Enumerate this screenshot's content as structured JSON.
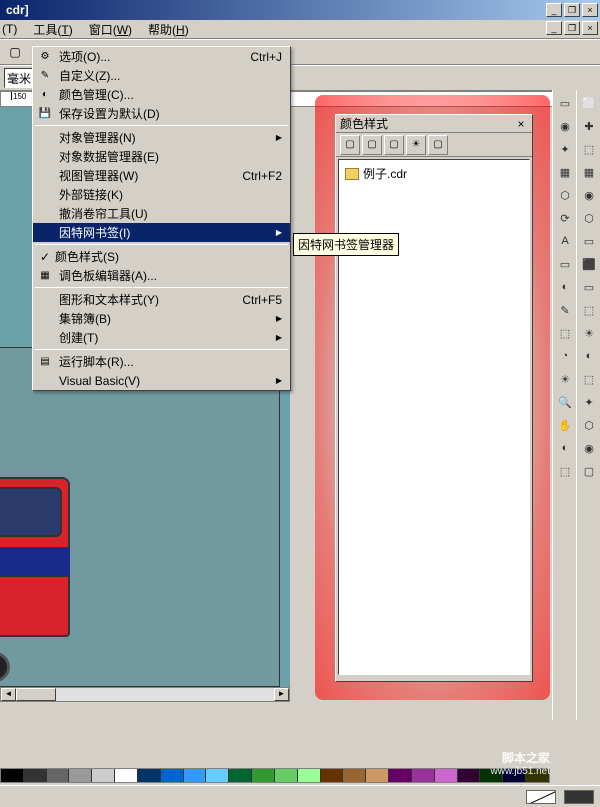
{
  "titlebar": {
    "text": "cdr]"
  },
  "menubar": {
    "items": [
      {
        "label": "工具",
        "key": "T"
      },
      {
        "label": "窗口",
        "key": "W"
      },
      {
        "label": "帮助",
        "key": "H"
      }
    ],
    "partial_left": "(T)"
  },
  "dropdown": {
    "items": [
      {
        "label": "选项(O)...",
        "shortcut": "Ctrl+J",
        "icon": "gear"
      },
      {
        "label": "自定义(Z)...",
        "icon": "custom"
      },
      {
        "label": "颜色管理(C)...",
        "icon": "color"
      },
      {
        "label": "保存设置为默认(D)",
        "icon": "save"
      },
      {
        "sep": true
      },
      {
        "label": "对象管理器(N)",
        "arrow": true
      },
      {
        "label": "对象数据管理器(E)"
      },
      {
        "label": "视图管理器(W)",
        "shortcut": "Ctrl+F2"
      },
      {
        "label": "外部链接(K)"
      },
      {
        "label": "撤消卷帘工具(U)"
      },
      {
        "label": "因特网书签(I)",
        "highlighted": true,
        "arrow": true
      },
      {
        "sep": true
      },
      {
        "label": "颜色样式(S)",
        "checked": true
      },
      {
        "label": "调色板编辑器(A)...",
        "icon": "palette"
      },
      {
        "sep": true
      },
      {
        "label": "图形和文本样式(Y)",
        "shortcut": "Ctrl+F5"
      },
      {
        "label": "集锦簿(B)",
        "arrow": true
      },
      {
        "label": "创建(T)",
        "arrow": true
      },
      {
        "sep": true
      },
      {
        "label": "运行脚本(R)...",
        "icon": "script"
      },
      {
        "label": "Visual Basic(V)",
        "arrow": true
      }
    ]
  },
  "tooltip": {
    "text": "因特网书签管理器"
  },
  "panel": {
    "title": "颜色样式",
    "file": "例子.cdr"
  },
  "ruler": {
    "marks": [
      "150"
    ]
  },
  "toolbar_input": {
    "value": "毫米"
  },
  "watermark": {
    "line1": "脚本之家",
    "line2": "www.jb51.net"
  },
  "palette_colors": [
    "#000000",
    "#333333",
    "#666666",
    "#999999",
    "#cccccc",
    "#ffffff",
    "#003366",
    "#0066cc",
    "#3399ff",
    "#66ccff",
    "#006633",
    "#339933",
    "#66cc66",
    "#99ff99",
    "#663300",
    "#996633",
    "#cc9966",
    "#660066",
    "#993399",
    "#cc66cc",
    "#330033",
    "#003300",
    "#000033",
    "#333300"
  ]
}
